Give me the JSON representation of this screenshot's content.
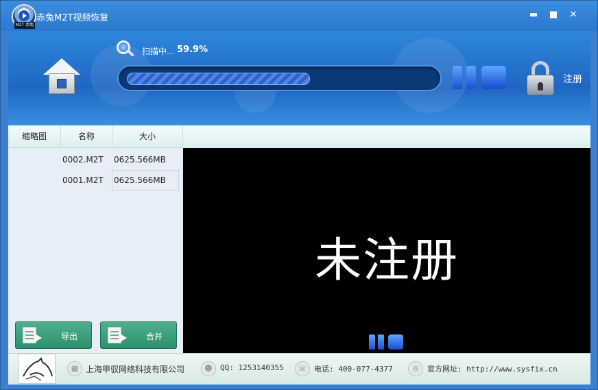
{
  "window": {
    "title": "赤兔M2T视频恢复",
    "logo_tag": "M2T 赤兔",
    "controls": {
      "minimize": "▬",
      "maximize": "■",
      "close": "✕"
    }
  },
  "scan": {
    "label": "扫描中...",
    "percent": "59.9%",
    "progress": 0.599
  },
  "register": {
    "label": "注册"
  },
  "file_list": {
    "columns": [
      "缩略图",
      "名称",
      "大小"
    ],
    "rows": [
      {
        "name": "0002.M2T",
        "size": "0625.566MB"
      },
      {
        "name": "0001.M2T",
        "size": "0625.566MB"
      }
    ]
  },
  "actions": {
    "export_label": "导出",
    "merge_label": "合并"
  },
  "preview": {
    "watermark": "未注册"
  },
  "footer": {
    "company": "上海甲驭网络科技有限公司",
    "qq": "QQ: 1253140355",
    "phone": "电话: 400-077-4377",
    "website": "官方网址: http://www.sysfix.cn"
  }
}
